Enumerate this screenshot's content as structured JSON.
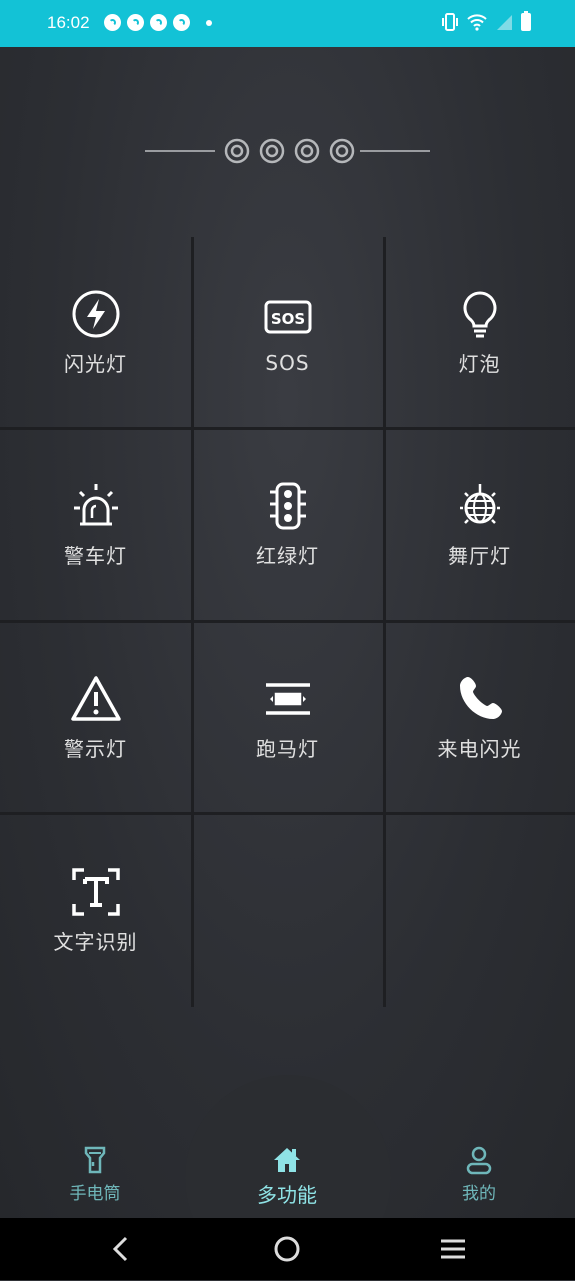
{
  "status_bar": {
    "time": "16:02",
    "icons": [
      "app-notification-icon",
      "app-notification-icon",
      "app-notification-icon",
      "app-notification-icon",
      "dot-icon",
      "vibrate-icon",
      "wifi-icon",
      "signal-icon",
      "battery-icon"
    ]
  },
  "grid": {
    "items": [
      {
        "label": "闪光灯",
        "icon": "flash-icon"
      },
      {
        "label": "SOS",
        "icon": "sos-icon"
      },
      {
        "label": "灯泡",
        "icon": "bulb-icon"
      },
      {
        "label": "警车灯",
        "icon": "siren-icon"
      },
      {
        "label": "红绿灯",
        "icon": "traffic-light-icon"
      },
      {
        "label": "舞厅灯",
        "icon": "disco-ball-icon"
      },
      {
        "label": "警示灯",
        "icon": "warning-icon"
      },
      {
        "label": "跑马灯",
        "icon": "marquee-icon"
      },
      {
        "label": "来电闪光",
        "icon": "phone-icon"
      },
      {
        "label": "文字识别",
        "icon": "text-recognition-icon"
      }
    ]
  },
  "bottom_nav": {
    "items": [
      {
        "label": "手电筒",
        "icon": "flashlight-icon",
        "active": false
      },
      {
        "label": "多功能",
        "icon": "home-icon",
        "active": true
      },
      {
        "label": "我的",
        "icon": "user-icon",
        "active": false
      }
    ]
  },
  "colors": {
    "status_bar": "#13c2d6",
    "accent": "#8fe3e6",
    "background": "#2f3136"
  }
}
